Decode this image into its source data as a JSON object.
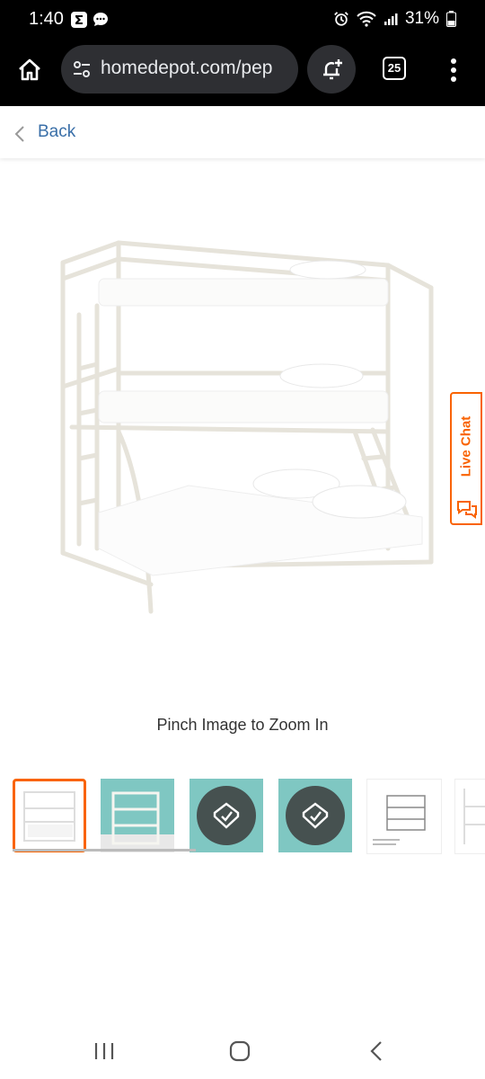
{
  "status_bar": {
    "time": "1:40",
    "battery": "31%"
  },
  "browser": {
    "url": "homedepot.com/pep",
    "tab_count": "25"
  },
  "back": {
    "label": "Back"
  },
  "product": {
    "zoom_hint": "Pinch Image to Zoom In"
  },
  "live_chat": {
    "label": "Live Chat"
  },
  "colors": {
    "accent": "#f96302",
    "link": "#3a6fa8"
  }
}
